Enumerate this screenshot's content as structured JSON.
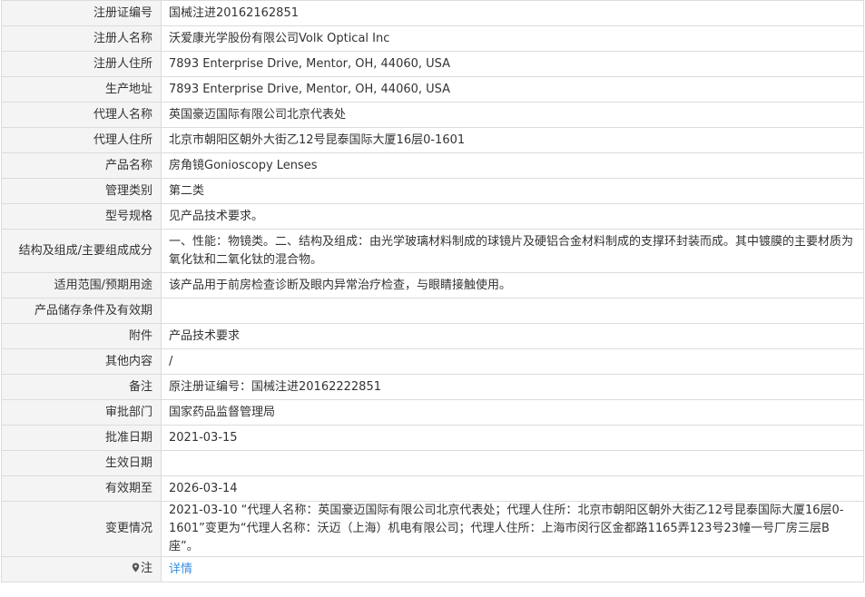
{
  "rows": [
    {
      "label": "注册证编号",
      "value": "国械注进20162162851"
    },
    {
      "label": "注册人名称",
      "value": "沃爱康光学股份有限公司Volk Optical Inc"
    },
    {
      "label": "注册人住所",
      "value": "7893 Enterprise Drive, Mentor, OH, 44060, USA"
    },
    {
      "label": "生产地址",
      "value": "7893 Enterprise Drive, Mentor, OH, 44060, USA"
    },
    {
      "label": "代理人名称",
      "value": "英国豪迈国际有限公司北京代表处"
    },
    {
      "label": "代理人住所",
      "value": "北京市朝阳区朝外大街乙12号昆泰国际大厦16层0-1601"
    },
    {
      "label": "产品名称",
      "value": "房角镜Gonioscopy Lenses"
    },
    {
      "label": "管理类别",
      "value": "第二类"
    },
    {
      "label": "型号规格",
      "value": "见产品技术要求。"
    },
    {
      "label": "结构及组成/主要组成成分",
      "value": "一、性能：物镜类。二、结构及组成：由光学玻璃材料制成的球镜片及硬铝合金材料制成的支撑环封装而成。其中镀膜的主要材质为氧化钛和二氧化钛的混合物。"
    },
    {
      "label": "适用范围/预期用途",
      "value": "该产品用于前房检查诊断及眼内异常治疗检查，与眼睛接触使用。"
    },
    {
      "label": "产品储存条件及有效期",
      "value": ""
    },
    {
      "label": "附件",
      "value": "产品技术要求"
    },
    {
      "label": "其他内容",
      "value": "/"
    },
    {
      "label": "备注",
      "value": "原注册证编号：国械注进20162222851"
    },
    {
      "label": "审批部门",
      "value": "国家药品监督管理局"
    },
    {
      "label": "批准日期",
      "value": "2021-03-15"
    },
    {
      "label": "生效日期",
      "value": ""
    },
    {
      "label": "有效期至",
      "value": "2026-03-14"
    },
    {
      "label": "变更情况",
      "value": "2021-03-10 “代理人名称：英国豪迈国际有限公司北京代表处；代理人住所：北京市朝阳区朝外大街乙12号昆泰国际大厦16层0-1601”变更为“代理人名称：沃迈（上海）机电有限公司；代理人住所：上海市闵行区金都路1165弄123号23幢一号厂房三层B座”。"
    }
  ],
  "note": {
    "label": "注",
    "icon": "map-pin-icon",
    "link_text": "详情"
  }
}
